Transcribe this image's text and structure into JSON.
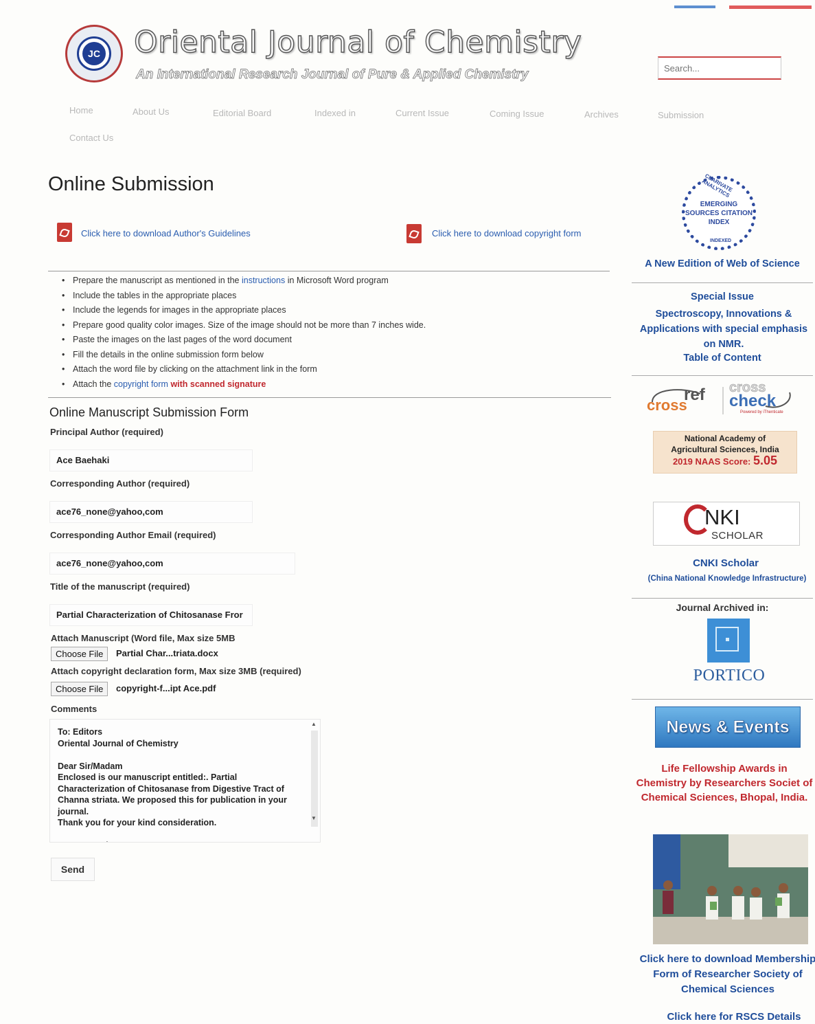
{
  "header": {
    "site_title": "Oriental Journal of Chemistry",
    "site_subtitle": "An International Research Journal of Pure & Applied Chemistry",
    "logo_text": "JC",
    "search_placeholder": "Search..."
  },
  "nav": {
    "items": [
      "Home",
      "About Us",
      "Editorial Board",
      "Indexed in",
      "Current Issue",
      "Coming Issue",
      "Archives",
      "Submission",
      "Contact Us"
    ]
  },
  "main": {
    "page_title": "Online Submission",
    "download_guidelines": "Click here to download Author's Guidelines",
    "download_copyright": "Click here to download copyright form",
    "instructions": {
      "item1_before": "Prepare the manuscript as mentioned in the ",
      "item1_link": "instructions",
      "item1_after": " in Microsoft Word program",
      "item2": "Include the tables in the appropriate places",
      "item3": "Include the legends for images in the appropriate places",
      "item4": "Prepare good quality color images. Size of the image should not be more than 7 inches wide.",
      "item5": "Paste the images on the last pages of the word document",
      "item6": "Fill the details in the online submission form below",
      "item7": "Attach the word file by clicking on the attachment link in the form",
      "item8_before": "Attach the ",
      "item8_link": "copyright form",
      "item8_after": " with scanned signature"
    },
    "form": {
      "title": "Online Manuscript Submission Form",
      "principal_author_label": "Principal Author (required)",
      "principal_author_value": "Ace Baehaki",
      "corresponding_author_label": "Corresponding Author (required)",
      "corresponding_author_value": "ace76_none@yahoo,com",
      "corresponding_email_label": "Corresponding Author Email (required)",
      "corresponding_email_value": "ace76_none@yahoo,com",
      "title_label": "Title of the manuscript (required)",
      "title_value": "Partial Characterization of Chitosanase Fror",
      "attach_manuscript_label": "Attach Manuscript (Word file, Max size 5MB",
      "choose_file_label": "Choose File",
      "manuscript_file": "Partial Char...triata.docx",
      "attach_copyright_label": "Attach copyright declaration form, Max size 3MB (required)",
      "copyright_file": "copyright-f...ipt Ace.pdf",
      "comments_label": "Comments",
      "comments_value": "To: Editors\nOriental Journal of Chemistry\n\nDear Sir/Madam\nEnclosed is our manuscript entitled:. Partial Characterization of Chitosanase from Digestive Tract of Channa striata. We proposed this for publication in your journal.\nThank you for your kind consideration.\n\nBest Regard",
      "send_label": "Send"
    }
  },
  "sidebar": {
    "esci_arc": "CLARIVATE ANALYTICS",
    "esci_text": "EMERGING SOURCES CITATION INDEX",
    "esci_bottom": "INDEXED",
    "web_of_science": "A New Edition of Web of Science",
    "special_issue": {
      "heading": "Special Issue",
      "text": "Spectroscopy, Innovations & Applications with special emphasis on NMR.",
      "toc": "Table of Content"
    },
    "crossref": {
      "cross": "cross",
      "ref": "ref",
      "cross2": "cross",
      "check": "check",
      "powered": "Powered by iThenticate"
    },
    "naas": {
      "line1": "National Academy of",
      "line2": "Agricultural Sciences, India",
      "score_label": "2019 NAAS Score:",
      "score_value": "5.05"
    },
    "cnki": {
      "logo_main": "NKI",
      "logo_sub": "SCHOLAR",
      "title": "CNKI Scholar",
      "subtitle": "(China National Knowledge Infrastructure)"
    },
    "archived_heading": "Journal Archived in:",
    "portico": "PORTICO",
    "news_events": "News & Events",
    "fellowship": "Life Fellowship Awards in Chemistry by Researchers Societ of Chemical Sciences, Bhopal, India.",
    "membership": "Click here to download Membership Form of Researcher Society of Chemical Sciences",
    "rscs": "Click here for RSCS Details"
  },
  "colors": {
    "link": "#2a5db0",
    "accent_red": "#c0282e",
    "sidebar_blue": "#1f4d9a"
  }
}
